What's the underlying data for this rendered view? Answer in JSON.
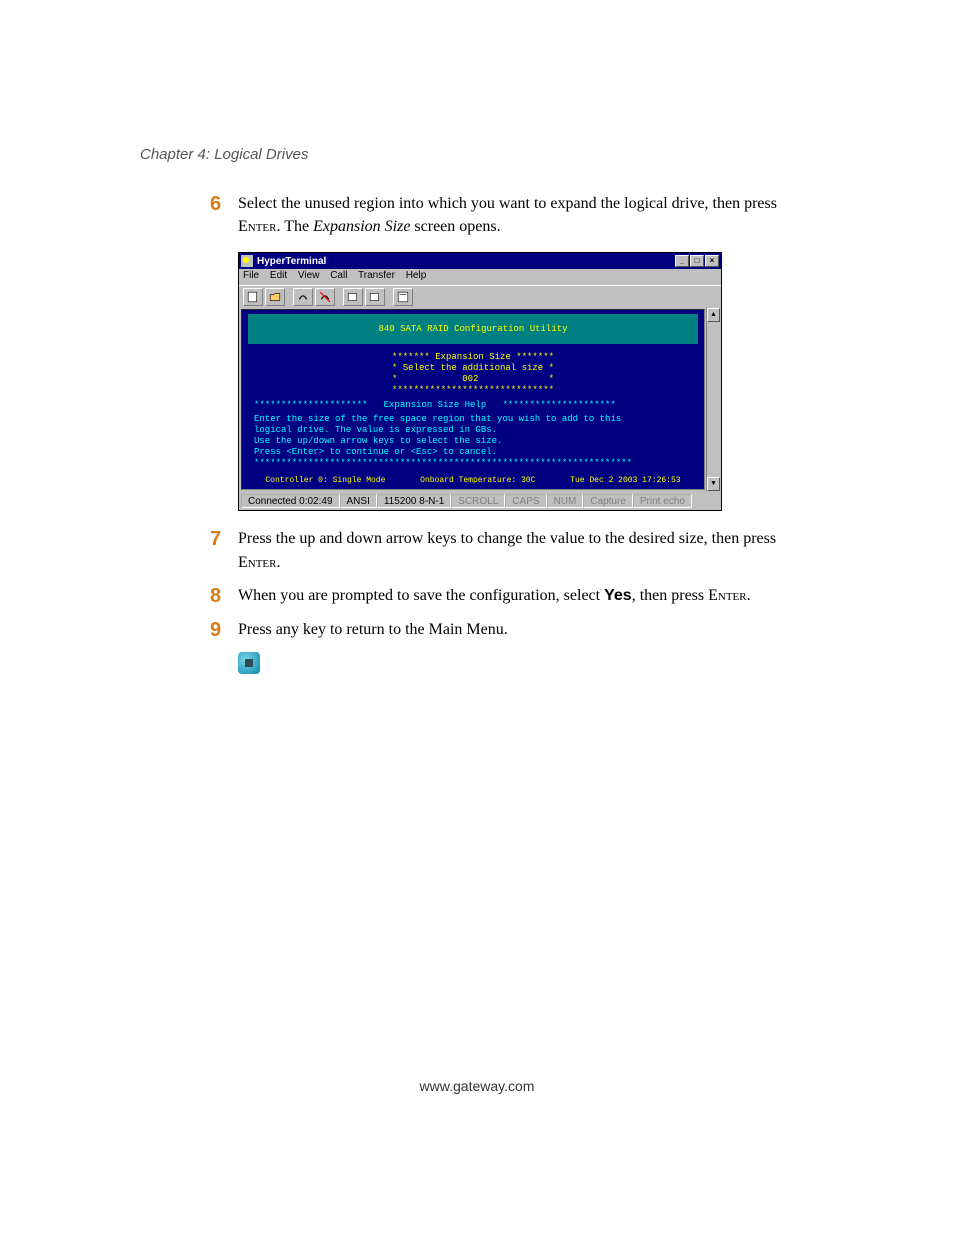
{
  "header": "Chapter 4: Logical Drives",
  "footer": "www.gateway.com",
  "steps": {
    "s6": {
      "num": "6",
      "pre": "Select the unused region into which you want to expand the logical drive, then press ",
      "enter": "Enter",
      "mid": ". The ",
      "italic": "Expansion Size",
      "post": " screen opens."
    },
    "s7": {
      "num": "7",
      "pre": "Press the up and down arrow keys to change the value to the desired size, then press ",
      "enter": "Enter",
      "post": "."
    },
    "s8": {
      "num": "8",
      "pre": "When you are prompted to save the configuration, select ",
      "yes": "Yes",
      "mid": ", then press ",
      "enter": "Enter",
      "post": "."
    },
    "s9": {
      "num": "9",
      "text": "Press any key to return to the Main Menu."
    }
  },
  "hyperterminal": {
    "title": "HyperTerminal",
    "menus": {
      "file": "File",
      "edit": "Edit",
      "view": "View",
      "call": "Call",
      "transfer": "Transfer",
      "help": "Help"
    },
    "utility_title": "840 SATA RAID Configuration Utility",
    "expansion": {
      "border_top": "******* Expansion Size *******",
      "line1": "* Select the additional size *",
      "line2": "*            002             *",
      "border_bot": "******************************"
    },
    "help": {
      "title_row": "*********************   Expansion Size Help   *********************",
      "l1": "Enter the size of the free space region that you wish to add to this",
      "l2": "logical drive. The value is expressed in GBs.",
      "l3": "Use the up/down arrow keys to select the size.",
      "l4": "Press <Enter> to continue or <Esc> to cancel.",
      "bottom": "**********************************************************************"
    },
    "status_teal": {
      "controller": "Controller 0:  Single Mode",
      "temp": "Onboard Temperature: 30C",
      "datetime": "Tue Dec 2 2003  17:26:53"
    },
    "statusbar": {
      "connected": "Connected 0:02:49",
      "emu": "ANSI",
      "baud": "115200 8-N-1",
      "scroll": "SCROLL",
      "caps": "CAPS",
      "num": "NUM",
      "capture": "Capture",
      "print": "Print echo"
    },
    "controls": {
      "min": "_",
      "max": "□",
      "close": "×"
    },
    "scroll_up": "▲",
    "scroll_down": "▼"
  }
}
